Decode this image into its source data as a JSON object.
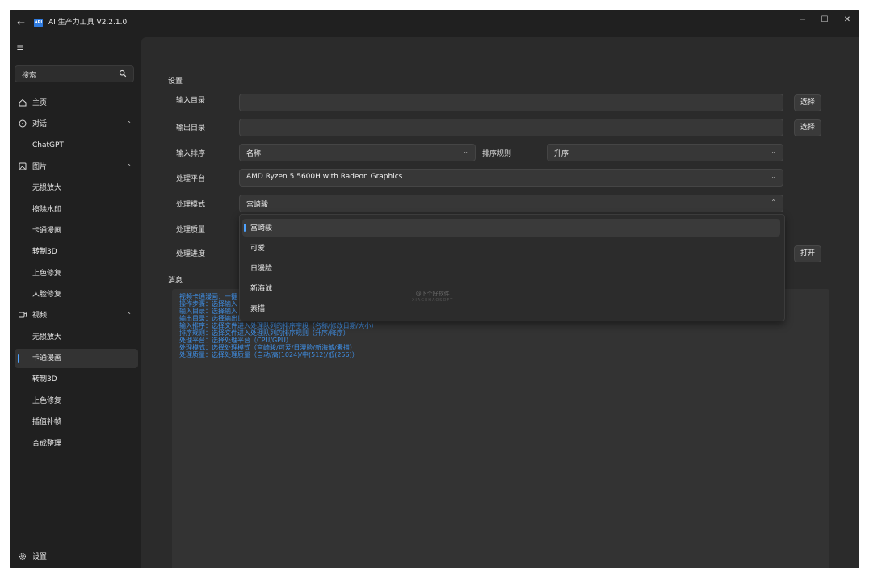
{
  "window": {
    "title": "AI 生产力工具 V2.2.1.0",
    "logo_text": "API",
    "controls": {
      "minimize": "−",
      "maximize": "☐",
      "close": "✕"
    }
  },
  "sidebar": {
    "search_placeholder": "搜索",
    "home": "主页",
    "chat": {
      "label": "对话",
      "items": [
        "ChatGPT"
      ]
    },
    "image": {
      "label": "图片",
      "items": [
        "无损放大",
        "擦除水印",
        "卡通漫画",
        "转制3D",
        "上色修复",
        "人脸修复"
      ]
    },
    "video": {
      "label": "视频",
      "items": [
        "无损放大",
        "卡通漫画",
        "转制3D",
        "上色修复",
        "插值补帧",
        "合成整理"
      ],
      "selected_index": 1
    },
    "settings": "设置"
  },
  "settings": {
    "section_title": "设置",
    "input_dir": {
      "label": "输入目录",
      "value": "",
      "button": "选择"
    },
    "output_dir": {
      "label": "输出目录",
      "value": "",
      "button": "选择"
    },
    "input_sort": {
      "label": "输入排序",
      "value": "名称",
      "rule_label": "排序规则",
      "rule_value": "升序"
    },
    "platform": {
      "label": "处理平台",
      "value": "AMD Ryzen 5 5600H with Radeon Graphics"
    },
    "mode": {
      "label": "处理模式",
      "value": "宫崎骏",
      "options": [
        "宫崎骏",
        "可爱",
        "日漫脸",
        "新海诚",
        "素描"
      ],
      "selected_index": 0
    },
    "quality": {
      "label": "处理质量"
    },
    "progress": {
      "label": "处理进度",
      "button": "打开"
    }
  },
  "messages": {
    "section_title": "消息",
    "lines": [
      "视频卡通漫画：一键",
      "操作步骤：选择输入",
      "输入目录：选择输入",
      "输出目录：选择输出目录位置",
      "输入排序：选择文件进入处理队列的排序字段（名称/修改日期/大小）",
      "排序规则：选择文件进入处理队列的排序规则（升序/降序）",
      "处理平台：选择处理平台（CPU/GPU）",
      "处理模式：选择处理模式（宫崎骏/可爱/日漫脸/新海诚/素描）",
      "处理质量：选择处理质量（自动/高(1024)/中(512)/低(256)）"
    ]
  },
  "watermark": {
    "line1": "@下个好软件",
    "line2": "XIAGEHAOSOFT"
  },
  "colors": {
    "accent": "#4fa3ff",
    "message_text": "#3f8fe6",
    "background": "#202020",
    "panel": "#2b2b2b"
  }
}
